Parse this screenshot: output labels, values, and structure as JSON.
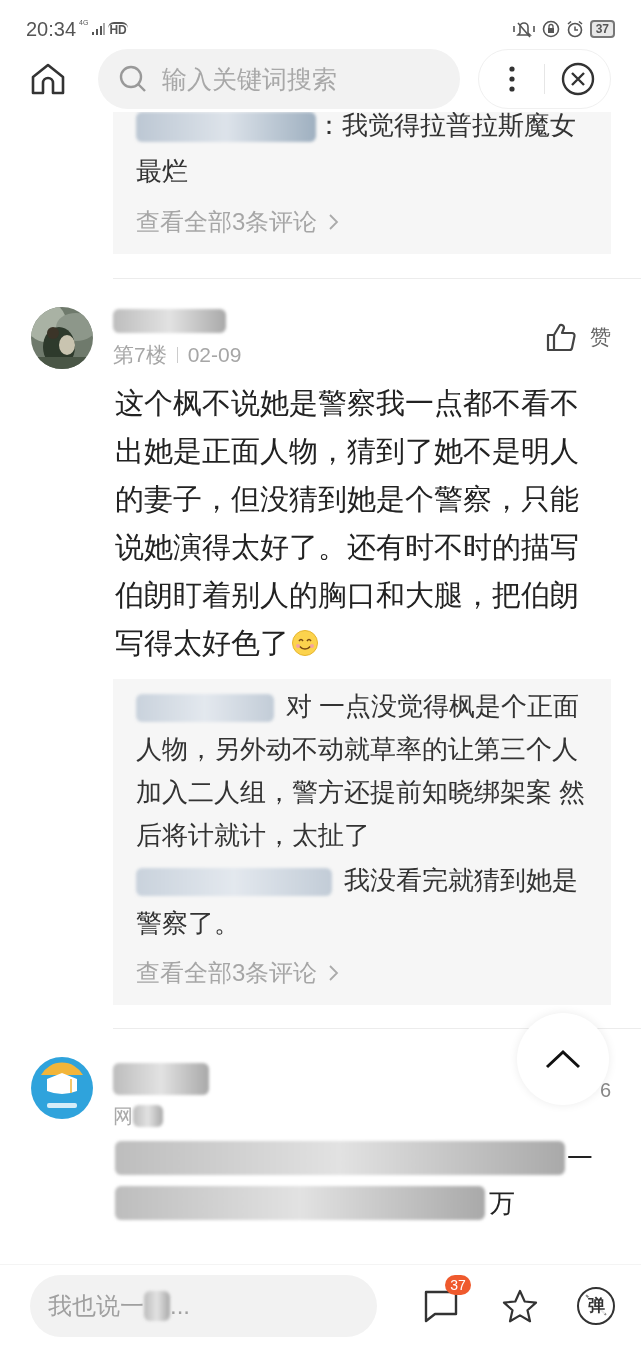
{
  "status_bar": {
    "time": "20:34",
    "network": "4G",
    "hd": "HD",
    "battery": "37"
  },
  "top_bar": {
    "search": {
      "placeholder": "输入关键词搜索"
    }
  },
  "comments": [
    {
      "kind": "reply_tail",
      "replies": [
        {
          "text": "：我觉得拉普拉斯魔女最烂"
        }
      ],
      "more": "查看全部3条评论"
    },
    {
      "kind": "comment",
      "floor": "第7楼",
      "date": "02-09",
      "like_label": "赞",
      "body": "这个枫不说她是警察我一点都不看不出她是正面人物，猜到了她不是明人的妻子，但没猜到她是个警察，只能说她演得太好了。还有时不时的描写伯朗盯着别人的胸口和大腿，把伯朗写得太好色了",
      "emoji": true,
      "replies": [
        {
          "text": "对 一点没觉得枫是个正面人物，另外动不动就草率的让第三个人加入二人组，警方还提前知晓绑架案 然后将计就计，太扯了"
        },
        {
          "text": "我没看完就猜到她是警察了。"
        }
      ],
      "more": "查看全部3条评论"
    },
    {
      "kind": "comment_blurred",
      "source": "网",
      "like_count": "6",
      "line_1_end": "一",
      "line_2_end": "万"
    }
  ],
  "bottom_bar": {
    "input": {
      "placeholder_start": "我也说一",
      "placeholder_end": "..."
    },
    "comment_count": "37",
    "danmaku_label": "弹"
  }
}
